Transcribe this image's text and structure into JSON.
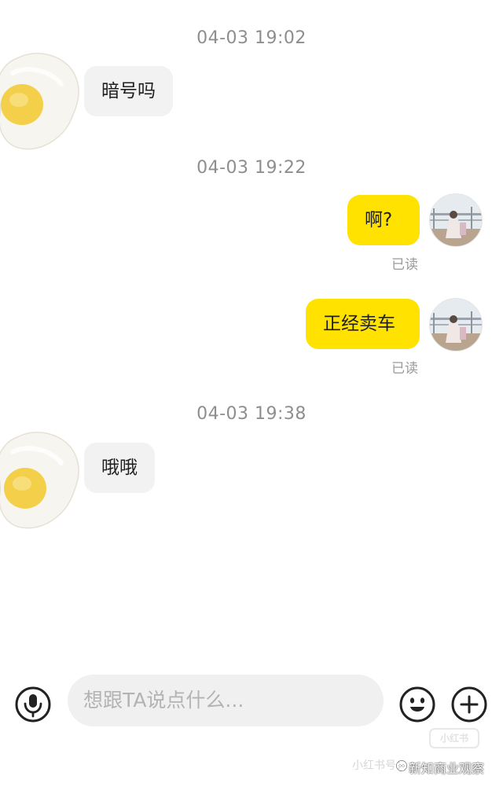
{
  "chat": {
    "timestamps": [
      "04-03 19:02",
      "04-03 19:22",
      "04-03 19:38"
    ],
    "messages": [
      {
        "sender": "other",
        "text": "暗号吗",
        "avatar": "fried-egg"
      },
      {
        "sender": "self",
        "text": "啊?",
        "status": "已读",
        "avatar": "profile-photo"
      },
      {
        "sender": "self",
        "text": "正经卖车",
        "status": "已读",
        "avatar": "profile-photo"
      },
      {
        "sender": "other",
        "text": "哦哦",
        "avatar": "fried-egg"
      }
    ]
  },
  "composer": {
    "placeholder": "想跟TA说点什么...",
    "voice_icon": "microphone-icon",
    "emoji_icon": "emoji-icon",
    "more_icon": "plus-icon"
  },
  "watermark": {
    "box_text": "小红书",
    "bottom_text": "小红书号：",
    "credit": "新知商业观察"
  },
  "colors": {
    "outgoing_bubble": "#ffe200",
    "incoming_bubble": "#f2f2f2",
    "timestamp": "#8e8e8e",
    "read_receipt": "#9a9a9a"
  }
}
